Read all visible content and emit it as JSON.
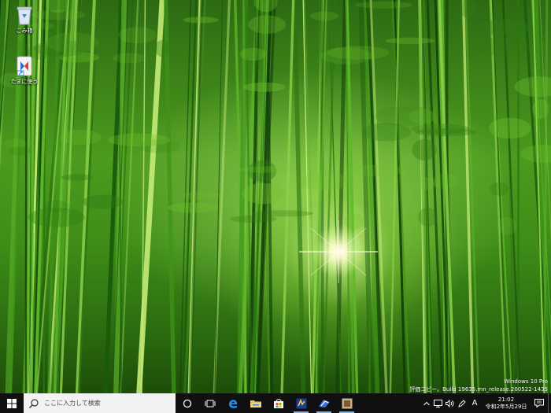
{
  "desktop": {
    "icons": [
      {
        "label": "ごみ箱",
        "icon": "recycle-bin-icon"
      },
      {
        "label": "たまに使う",
        "icon": "folder-shortcut-icon"
      }
    ],
    "watermark": {
      "edition": "Windows 10 Pro",
      "build": "評価コピー。Build 19635.mn_release.200522-1435"
    }
  },
  "taskbar": {
    "start_icon": "windows-logo-icon",
    "search_placeholder": "ここに入力して検索",
    "apps": [
      {
        "icon": "cortana-icon",
        "running": false
      },
      {
        "icon": "task-view-icon",
        "running": false
      },
      {
        "icon": "edge-icon",
        "running": false
      },
      {
        "icon": "file-explorer-icon",
        "running": false
      },
      {
        "icon": "store-icon",
        "running": false
      },
      {
        "icon": "app-icon",
        "running": true
      },
      {
        "icon": "app-icon",
        "running": true
      },
      {
        "icon": "app-icon",
        "running": true
      }
    ],
    "tray": {
      "ime": "A",
      "time": "21:02",
      "date": "令和2年5月29日"
    },
    "colors": {
      "taskbar": "#101010",
      "accent": "#7ab3e8"
    }
  }
}
